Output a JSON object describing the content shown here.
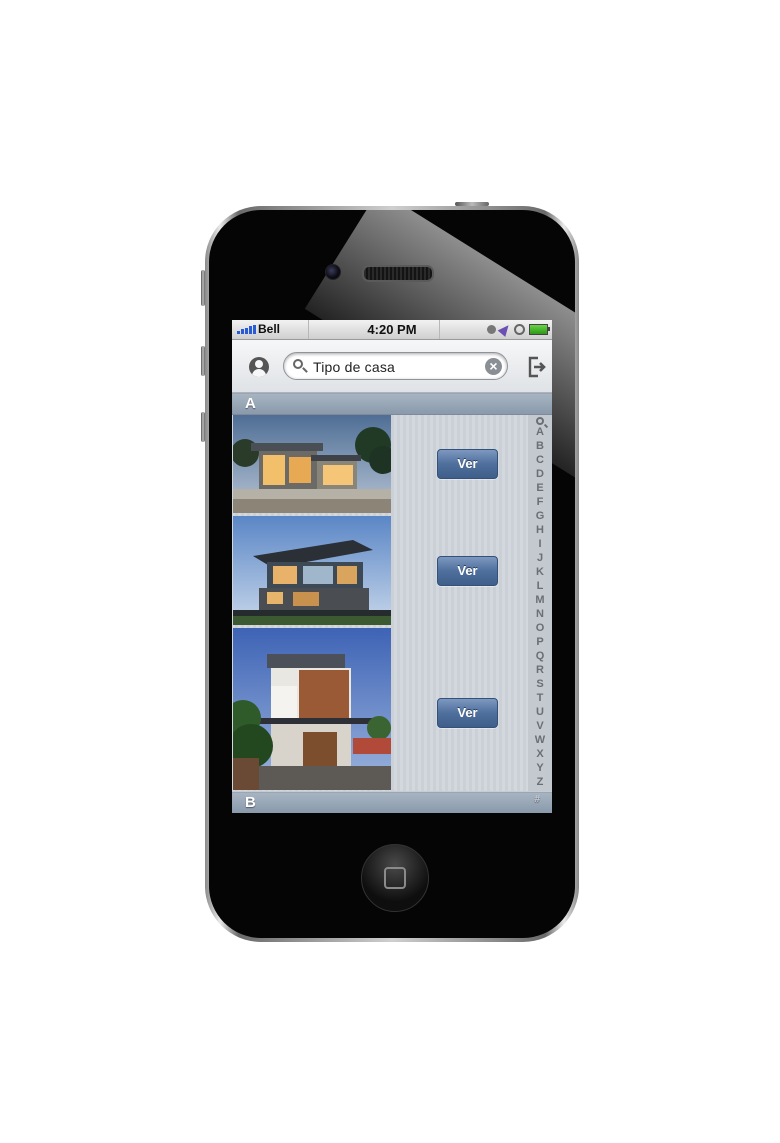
{
  "status_bar": {
    "carrier": "Bell",
    "time": "4:20 PM",
    "colors": {
      "signal": "#2a5bd6",
      "battery": "#3fb02a",
      "location": "#6b4fb3"
    }
  },
  "nav_bar": {
    "search": {
      "value": "Tipo de casa",
      "placeholder": "Tipo de casa"
    },
    "icons": {
      "left": "user-circle-icon",
      "right": "logout-icon",
      "search": "magnifier-icon",
      "clear": "clear-icon"
    }
  },
  "sections": [
    {
      "letter": "A"
    },
    {
      "letter": "B"
    }
  ],
  "listings": [
    {
      "button_label": "Ver",
      "image": "modern-house-dusk"
    },
    {
      "button_label": "Ver",
      "image": "modern-house-cantilever"
    },
    {
      "button_label": "Ver",
      "image": "modern-house-wood-facade"
    }
  ],
  "section_index": [
    "A",
    "B",
    "C",
    "D",
    "E",
    "F",
    "G",
    "H",
    "I",
    "J",
    "K",
    "L",
    "M",
    "N",
    "O",
    "P",
    "Q",
    "R",
    "S",
    "T",
    "U",
    "V",
    "W",
    "X",
    "Y",
    "Z"
  ],
  "section_index_extra": "#",
  "theme": {
    "button_blue": "#4f6f9c",
    "header_gray": "#9aa8b8"
  }
}
